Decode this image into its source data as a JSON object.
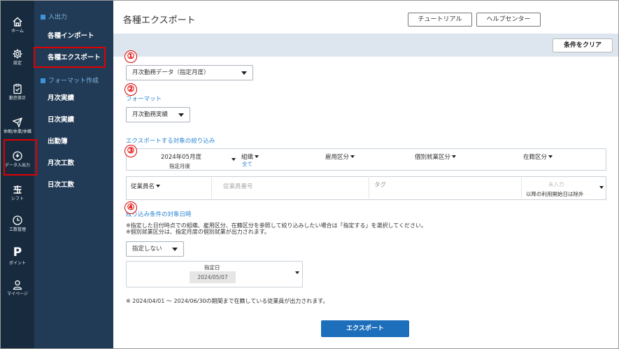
{
  "rail": {
    "home": "ホーム",
    "settings": "設定",
    "attendance_fix": "勤怠修正",
    "leave": "休暇/休業/休職",
    "data_io": "データ入出力",
    "shift": "シフト",
    "hours": "工数管理",
    "points_glyph": "P",
    "points": "ポイント",
    "mypage": "マイページ"
  },
  "subnav": {
    "io_section": "入出力",
    "import": "各種インポート",
    "export": "各種エクスポート",
    "format_section": "フォーマット作成",
    "items": [
      "月次実績",
      "日次実績",
      "出勤簿",
      "月次工数",
      "日次工数"
    ]
  },
  "main": {
    "title": "各種エクスポート",
    "tutorial": "チュートリアル",
    "help_center": "ヘルプセンター",
    "clear_conditions": "条件をクリア",
    "export_type": "月次勤務データ（指定月度）",
    "format_label": "フォーマット",
    "format_value": "月次勤務実績",
    "filter_label": "エクスポートする対象の絞り込み",
    "month_value": "2024年05月度",
    "month_sub": "指定月度",
    "org_label": "組織",
    "org_value": "全て",
    "employment_label": "雇用区分",
    "work_type_label": "個別就業区分",
    "status_label": "在籍区分",
    "employee_name_label": "従業員名",
    "employee_number_placeholder": "従業員番号",
    "tag_placeholder": "タグ",
    "unset_placeholder": "未入力",
    "usage_exclude": "以降の利用開始日は除外",
    "target_date_label": "絞り込み条件の対象日時",
    "note1": "※指定した日付時点での組織、雇用区分、在籍区分を参照して絞り込みしたい場合は「指定する」を選択してください。",
    "note2": "※個別就業区分は、指定月度の個別就業が出力されます。",
    "specify_value": "指定しない",
    "date_label": "指定日",
    "date_value": "2024/05/07",
    "period_note": "※ 2024/04/01 ～ 2024/06/30の期間まで在籍している従業員が出力されます。",
    "export_button": "エクスポート"
  },
  "annotations": [
    "①",
    "②",
    "③",
    "④"
  ],
  "colors": {
    "rail_bg": "#182b3e",
    "subnav_bg": "#213a55",
    "accent_blue": "#2b85d3",
    "export_button": "#1d6fbb",
    "annotation_red": "#e00000"
  }
}
